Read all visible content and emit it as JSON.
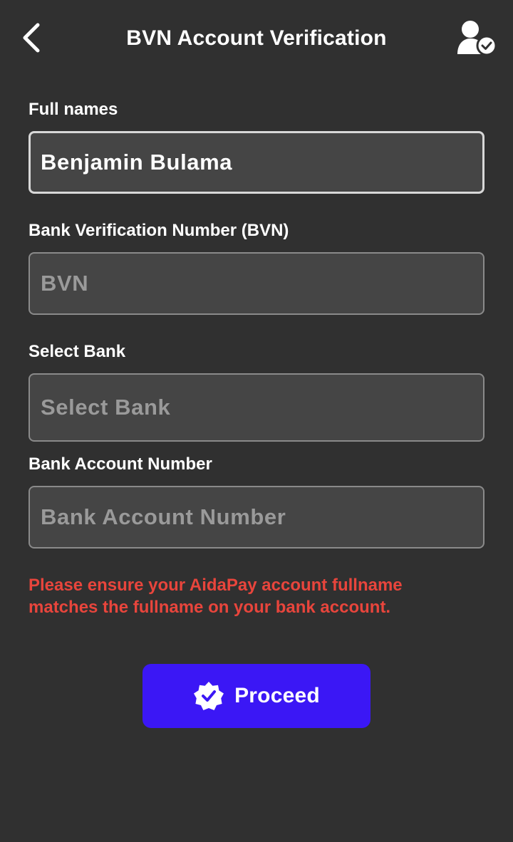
{
  "header": {
    "title": "BVN Account Verification",
    "back_icon": "chevron-left-icon",
    "user_icon": "user-verified-icon"
  },
  "form": {
    "full_names": {
      "label": "Full names",
      "value": "Benjamin Bulama"
    },
    "bvn": {
      "label": "Bank Verification Number (BVN)",
      "placeholder": "BVN"
    },
    "bank": {
      "label": "Select Bank",
      "placeholder": "Select Bank"
    },
    "account_number": {
      "label": "Bank Account Number",
      "placeholder": "Bank Account Number"
    }
  },
  "warning": "Please ensure your AidaPay account fullname matches the fullname on your bank account.",
  "proceed": {
    "label": "Proceed",
    "icon": "verified-badge-icon"
  },
  "colors": {
    "background": "#303030",
    "field_background": "#454545",
    "warning": "#e8453c",
    "primary": "#3b17f5"
  }
}
